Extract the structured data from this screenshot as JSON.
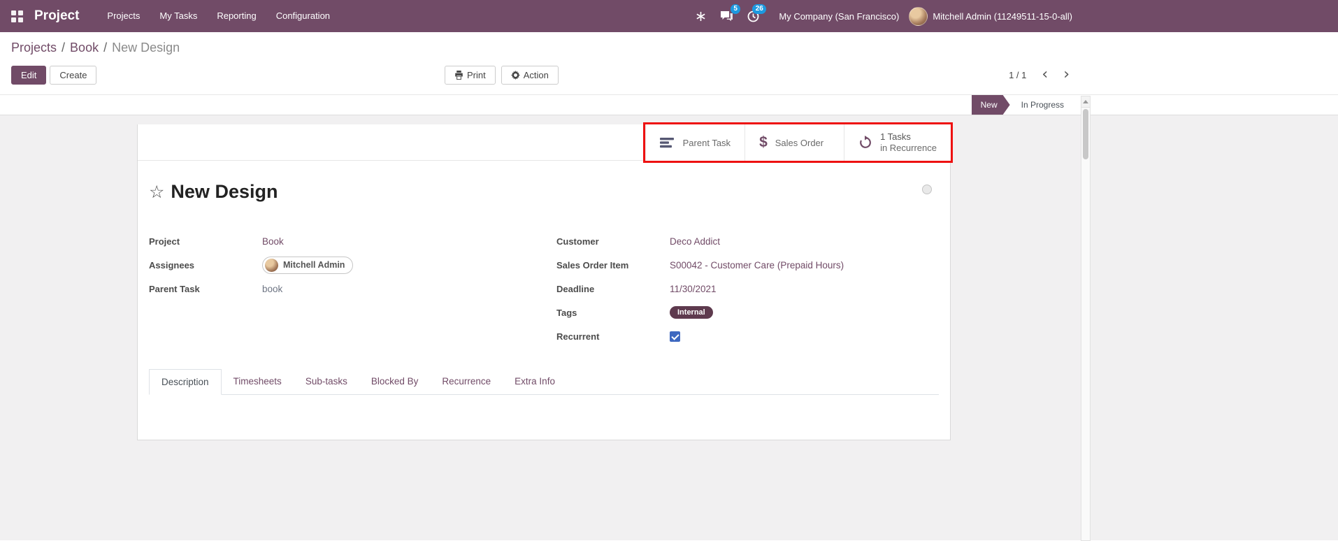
{
  "colors": {
    "primary": "#714B67",
    "nav_badge": "#1d99e0",
    "tag_internal": "#5e3a4e",
    "annotation_red": "#ee1111",
    "checkbox_checked": "#3e68c0"
  },
  "navbar": {
    "app": "Project",
    "menu": [
      "Projects",
      "My Tasks",
      "Reporting",
      "Configuration"
    ],
    "messages_badge": "5",
    "activities_badge": "26",
    "company": "My Company (San Francisco)",
    "user": "Mitchell Admin (11249511-15-0-all)"
  },
  "breadcrumb": {
    "parents": [
      "Projects",
      "Book"
    ],
    "current": "New Design",
    "separator": "/"
  },
  "control_panel": {
    "edit": "Edit",
    "create": "Create",
    "print": "Print",
    "action": "Action",
    "pager": "1 / 1"
  },
  "statusbar": {
    "active_stage": "New",
    "other_stages": [
      "In Progress"
    ]
  },
  "button_box": [
    {
      "label": "Parent Task",
      "icon": "tasks-icon"
    },
    {
      "label": "Sales Order",
      "icon": "dollar-icon"
    },
    {
      "line1": "1 Tasks",
      "line2": "in Recurrence",
      "icon": "refresh-icon"
    }
  ],
  "form": {
    "title": "New Design",
    "fields_left": [
      {
        "label": "Project",
        "value": "Book"
      },
      {
        "label": "Assignees",
        "value": "Mitchell Admin"
      },
      {
        "label": "Parent Task",
        "value": "book"
      }
    ],
    "fields_right": [
      {
        "label": "Customer",
        "value": "Deco Addict"
      },
      {
        "label": "Sales Order Item",
        "value": "S00042 - Customer Care (Prepaid Hours)"
      },
      {
        "label": "Deadline",
        "value": "11/30/2021"
      },
      {
        "label": "Tags",
        "value": "Internal"
      },
      {
        "label": "Recurrent",
        "checked": true
      }
    ],
    "tabs": [
      "Description",
      "Timesheets",
      "Sub-tasks",
      "Blocked By",
      "Recurrence",
      "Extra Info"
    ],
    "active_tab": "Description",
    "favorite_glyph": "☆",
    "chevron_left": "‹",
    "chevron_right": "›"
  }
}
